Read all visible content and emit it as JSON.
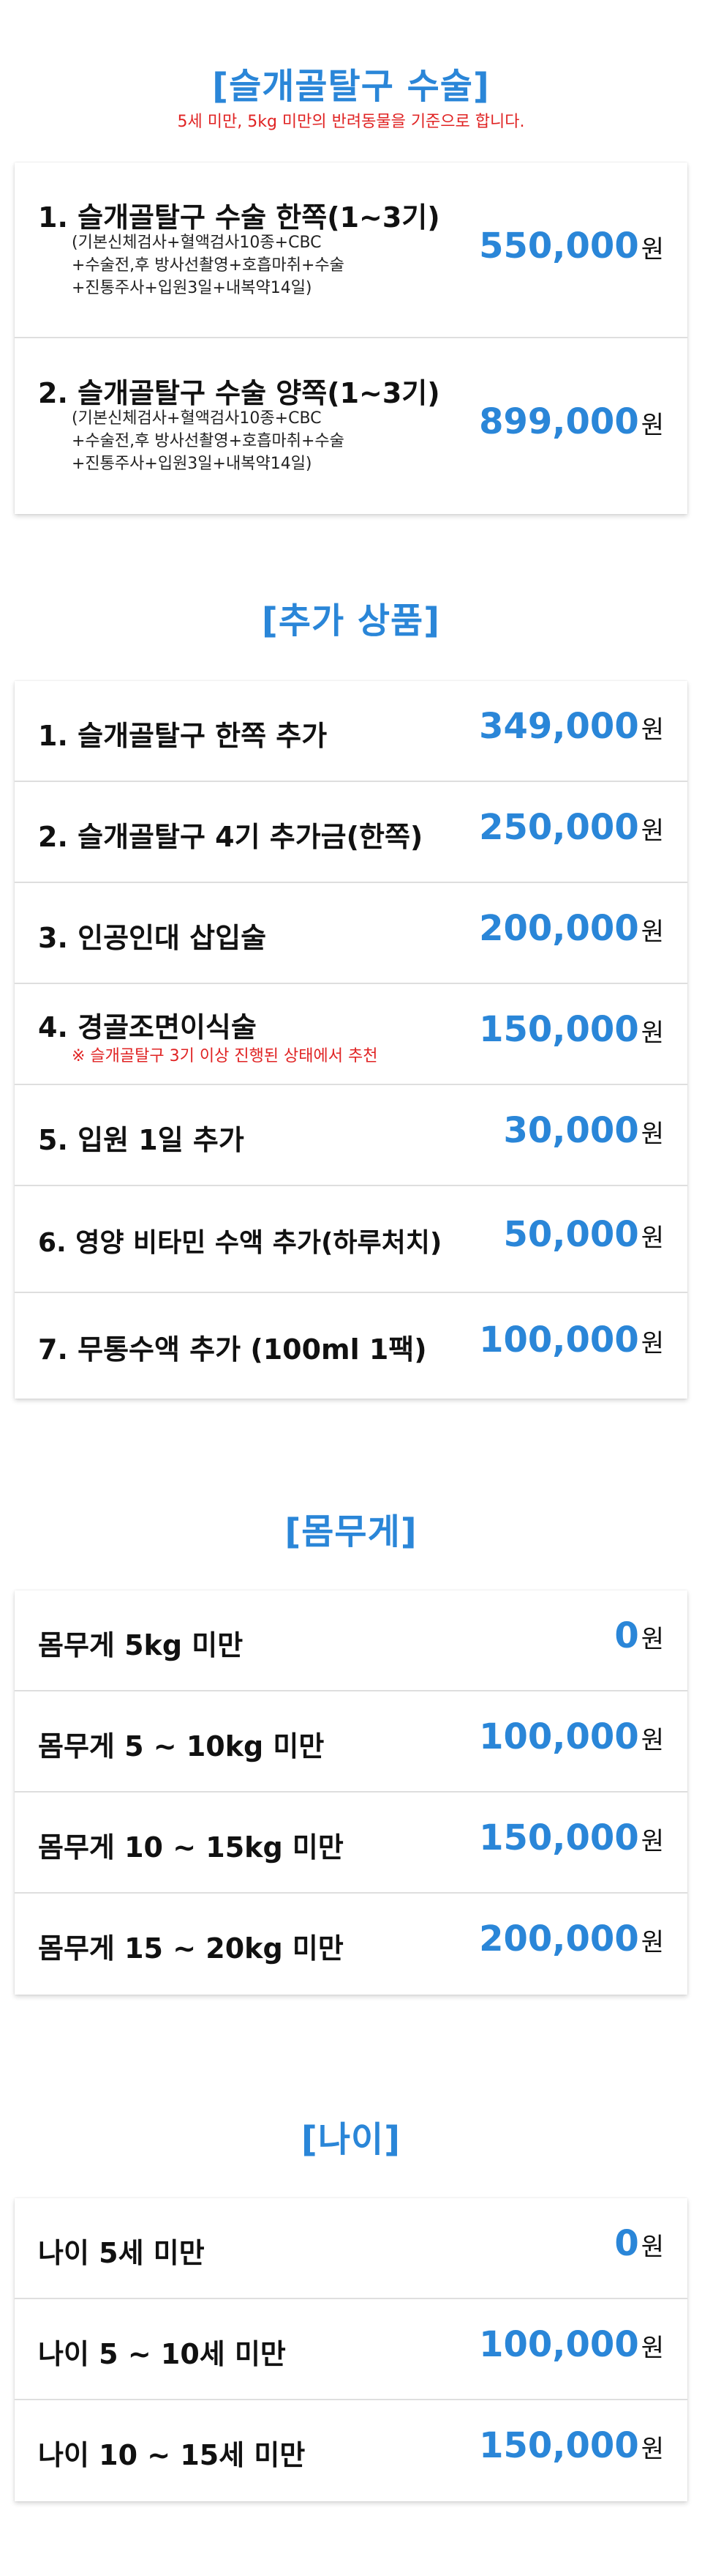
{
  "surgery": {
    "title": "[슬개골탈구 수술]",
    "note": "5세 미만, 5kg 미만의 반려동물을 기준으로 합니다.",
    "items": [
      {
        "label": "1. 슬개골탈구 수술 한쪽(1~3기)",
        "details": [
          "(기본신체검사+혈액검사10종+CBC",
          "+수술전,후 방사선촬영+호흡마취+수술",
          "+진통주사+입원3일+내복약14일)"
        ],
        "amount": "550,000",
        "unit": "원"
      },
      {
        "label": "2. 슬개골탈구 수술 양쪽(1~3기)",
        "details": [
          "(기본신체검사+혈액검사10종+CBC",
          "+수술전,후 방사선촬영+호흡마취+수술",
          "+진통주사+입원3일+내복약14일)"
        ],
        "amount": "899,000",
        "unit": "원"
      }
    ]
  },
  "addons": {
    "title": "[추가 상품]",
    "items": [
      {
        "label": "1. 슬개골탈구 한쪽 추가",
        "amount": "349,000",
        "unit": "원"
      },
      {
        "label": "2. 슬개골탈구 4기 추가금(한쪽)",
        "amount": "250,000",
        "unit": "원"
      },
      {
        "label": "3. 인공인대 삽입술",
        "amount": "200,000",
        "unit": "원"
      },
      {
        "label": "4. 경골조면이식술",
        "note": "※ 슬개골탈구 3기 이상 진행된 상태에서 추천",
        "amount": "150,000",
        "unit": "원"
      },
      {
        "label": "5. 입원 1일 추가",
        "amount": "30,000",
        "unit": "원"
      },
      {
        "label": "6. 영양 비타민 수액 추가(하루처치)",
        "amount": "50,000",
        "unit": "원"
      },
      {
        "label": "7. 무통수액 추가 (100ml 1팩)",
        "amount": "100,000",
        "unit": "원"
      }
    ]
  },
  "weight": {
    "title": "[몸무게]",
    "items": [
      {
        "label": "몸무게 5kg 미만",
        "amount": "0",
        "unit": "원"
      },
      {
        "label": "몸무게 5 ~ 10kg 미만",
        "amount": "100,000",
        "unit": "원"
      },
      {
        "label": "몸무게 10 ~ 15kg 미만",
        "amount": "150,000",
        "unit": "원"
      },
      {
        "label": "몸무게 15 ~ 20kg 미만",
        "amount": "200,000",
        "unit": "원"
      }
    ]
  },
  "age": {
    "title": "[나이]",
    "items": [
      {
        "label": "나이 5세 미만",
        "amount": "0",
        "unit": "원"
      },
      {
        "label": "나이 5 ~ 10세 미만",
        "amount": "100,000",
        "unit": "원"
      },
      {
        "label": "나이 10 ~ 15세 미만",
        "amount": "150,000",
        "unit": "원"
      }
    ]
  },
  "colors": {
    "accent": "#2a86d8",
    "note_red": "#e02323",
    "text": "#111111",
    "divider": "#dedede"
  }
}
